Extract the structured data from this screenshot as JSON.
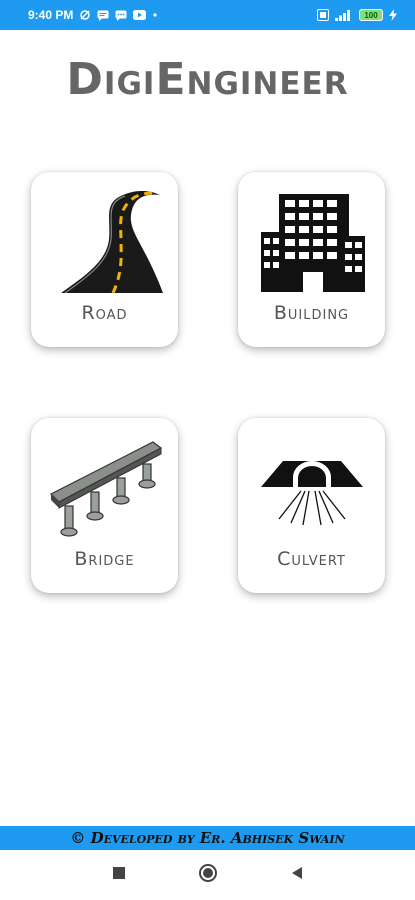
{
  "status_bar": {
    "time": "9:40 PM",
    "battery": "100",
    "left_icons": [
      "sync-icon",
      "message-icon",
      "chat-icon",
      "youtube-icon",
      "dot-icon"
    ],
    "right_icons": [
      "data-icon",
      "signal-icon",
      "battery-icon",
      "charging-icon"
    ]
  },
  "app": {
    "title": "DigiEngineer"
  },
  "cards": [
    {
      "label": "Road",
      "icon": "road-icon"
    },
    {
      "label": "Building",
      "icon": "building-icon"
    },
    {
      "label": "Bridge",
      "icon": "bridge-icon"
    },
    {
      "label": "Culvert",
      "icon": "culvert-icon"
    }
  ],
  "footer": {
    "text": "© Developed by Er. Abhisek Swain"
  },
  "nav": {
    "buttons": [
      "recents-button",
      "home-button",
      "back-button"
    ]
  }
}
